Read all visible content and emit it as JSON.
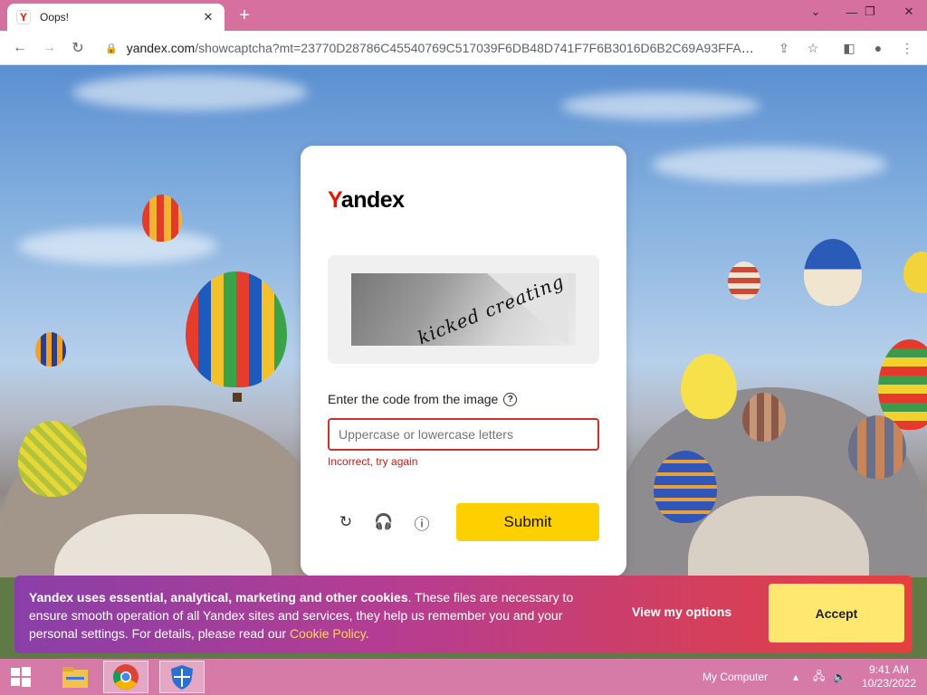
{
  "browser": {
    "tab_title": "Oops!",
    "tab_favicon_letter": "Y",
    "new_tab": "+",
    "url_host": "yandex.com",
    "url_path": "/showcaptcha?mt=23770D28786C45540769C517039F6DB48D741F7F6B3016D6B2C69A93FFA36105..."
  },
  "captcha": {
    "logo_y": "Y",
    "logo_rest": "andex",
    "image_text": "kicked creating",
    "prompt": "Enter the code from the image",
    "help_icon_glyph": "?",
    "placeholder": "Uppercase or lowercase letters",
    "error": "Incorrect, try again",
    "submit_label": "Submit",
    "icons": [
      "refresh-icon",
      "audio-icon",
      "info-icon"
    ]
  },
  "cookie_banner": {
    "bold": "Yandex uses essential, analytical, marketing and other cookies",
    "body": ". These files are necessary to ensure smooth operation of all Yandex sites and services, they help us remember you and your personal settings. For details, please read our ",
    "link": "Cookie Policy",
    "end": ".",
    "options_label": "View my options",
    "accept_label": "Accept"
  },
  "taskbar": {
    "computer_label": "My Computer",
    "time": "9:41 AM",
    "date": "10/23/2022"
  },
  "colors": {
    "accent": "#ffd000",
    "error": "#d12e2e",
    "yandex_red": "#e61400"
  }
}
